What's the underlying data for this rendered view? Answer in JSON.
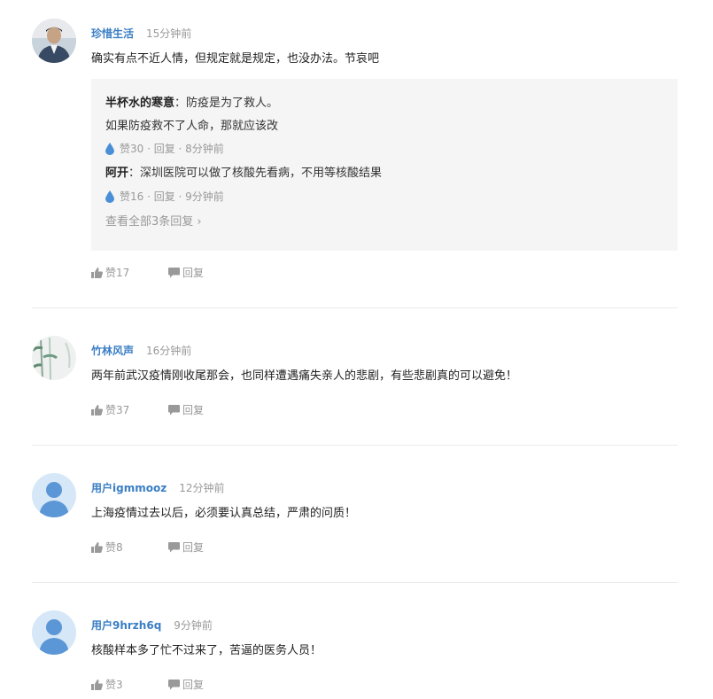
{
  "comments": [
    {
      "username": "珍惜生活",
      "time": "15分钟前",
      "content": "确实有点不近人情，但规定就是规定，也没办法。节哀吧",
      "like_label": "赞17",
      "reply_label": "回复",
      "replies": [
        {
          "name": "半杯水的寒意",
          "sep": "：",
          "text": "防疫是为了救人。",
          "text2": "如果防疫救不了人命，那就应该改",
          "meta": "赞30 · 回复 · 8分钟前"
        },
        {
          "name": "阿开",
          "sep": "：",
          "text": "深圳医院可以做了核酸先看病，不用等核酸结果",
          "meta": "赞16 · 回复 · 9分钟前"
        }
      ],
      "see_all": "查看全部3条回复"
    },
    {
      "username": "竹林风声",
      "time": "16分钟前",
      "content": "两年前武汉疫情刚收尾那会，也同样遭遇痛失亲人的悲剧，有些悲剧真的可以避免！",
      "like_label": "赞37",
      "reply_label": "回复"
    },
    {
      "username": "用户igmmooz",
      "time": "12分钟前",
      "content": "上海疫情过去以后，必须要认真总结，严肃的问质！",
      "like_label": "赞8",
      "reply_label": "回复"
    },
    {
      "username": "用户9hrzh6q",
      "time": "9分钟前",
      "content": "核酸样本多了忙不过来了，苦逼的医务人员！",
      "like_label": "赞3",
      "reply_label": "回复"
    }
  ],
  "colors": {
    "username": "#3a7ec4",
    "muted": "#999999",
    "reply_bg": "#f5f5f5",
    "divider": "#ebebeb",
    "drop_icon": "#4a8fd6"
  }
}
